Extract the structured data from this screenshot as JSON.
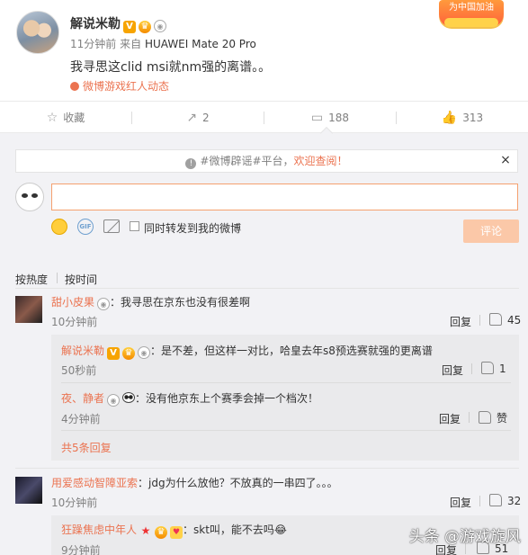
{
  "post": {
    "author": "解说米勒",
    "time": "11分钟前",
    "from_label": "来自",
    "device": "HUAWEI Mate 20 Pro",
    "text": "我寻思这clid msi就nm强的离谱。。",
    "topic": "微博游戏红人动态",
    "ribbon": "为中国加油"
  },
  "actions": {
    "favorite": "收藏",
    "forward": "2",
    "comment": "188",
    "like": "313"
  },
  "notice": {
    "prefix": "#微博辟谣#平台，",
    "highlight": "欢迎查阅！",
    "close": "×"
  },
  "composer": {
    "forward_label": "同时转发到我的微博",
    "submit": "评论",
    "gif": "GIF"
  },
  "sort": {
    "hot": "按热度",
    "time": "按时间"
  },
  "comments": [
    {
      "name": "甜小皮果",
      "text": "：我寻思在京东也没有很差啊",
      "time": "10分钟前",
      "reply": "回复",
      "likes": "45",
      "replies": [
        {
          "name": "解说米勒",
          "text": "：是不差，但这样一对比，哈皇去年s8预选赛就强的更离谱",
          "time": "50秒前",
          "reply": "回复",
          "likes": "1"
        },
        {
          "name": "夜、静者",
          "text": "：没有他京东上个赛季会掉一个档次！",
          "time": "4分钟前",
          "reply": "回复",
          "likes": "赞"
        }
      ],
      "more": "共5条回复"
    },
    {
      "name": "用爱感动智障亚索",
      "text": "：jdg为什么放他？不放真的一串四了。。。",
      "time": "10分钟前",
      "reply": "回复",
      "likes": "32",
      "replies": [
        {
          "name": "狂躁焦虑中年人",
          "text": "：skt叫，能不去吗😂",
          "time": "9分钟前",
          "reply": "回复",
          "likes": "51"
        }
      ]
    }
  ],
  "watermark": "头条 @游戏旋风"
}
